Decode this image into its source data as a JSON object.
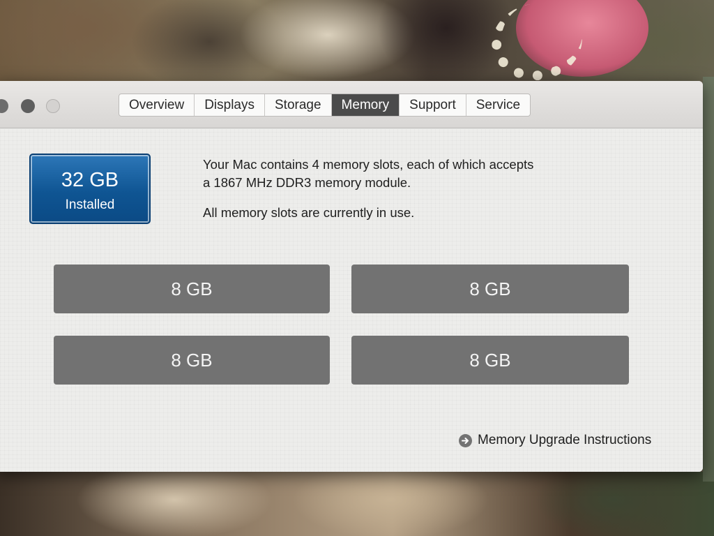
{
  "tabs": [
    {
      "label": "Overview"
    },
    {
      "label": "Displays"
    },
    {
      "label": "Storage"
    },
    {
      "label": "Memory"
    },
    {
      "label": "Support"
    },
    {
      "label": "Service"
    }
  ],
  "active_tab": "Memory",
  "installed": {
    "size": "32 GB",
    "label": "Installed"
  },
  "description": {
    "line1": "Your Mac contains 4 memory slots, each of which accepts",
    "line2": "a 1867 MHz DDR3 memory module.",
    "status": "All memory slots are currently in use."
  },
  "slots": [
    {
      "size": "8 GB"
    },
    {
      "size": "8 GB"
    },
    {
      "size": "8 GB"
    },
    {
      "size": "8 GB"
    }
  ],
  "upgrade_link": {
    "label": "Memory Upgrade Instructions",
    "icon": "arrow-circle-icon"
  },
  "colors": {
    "accent": "#0f5593",
    "active_tab": "#4b4b4b",
    "slot": "#727272"
  }
}
